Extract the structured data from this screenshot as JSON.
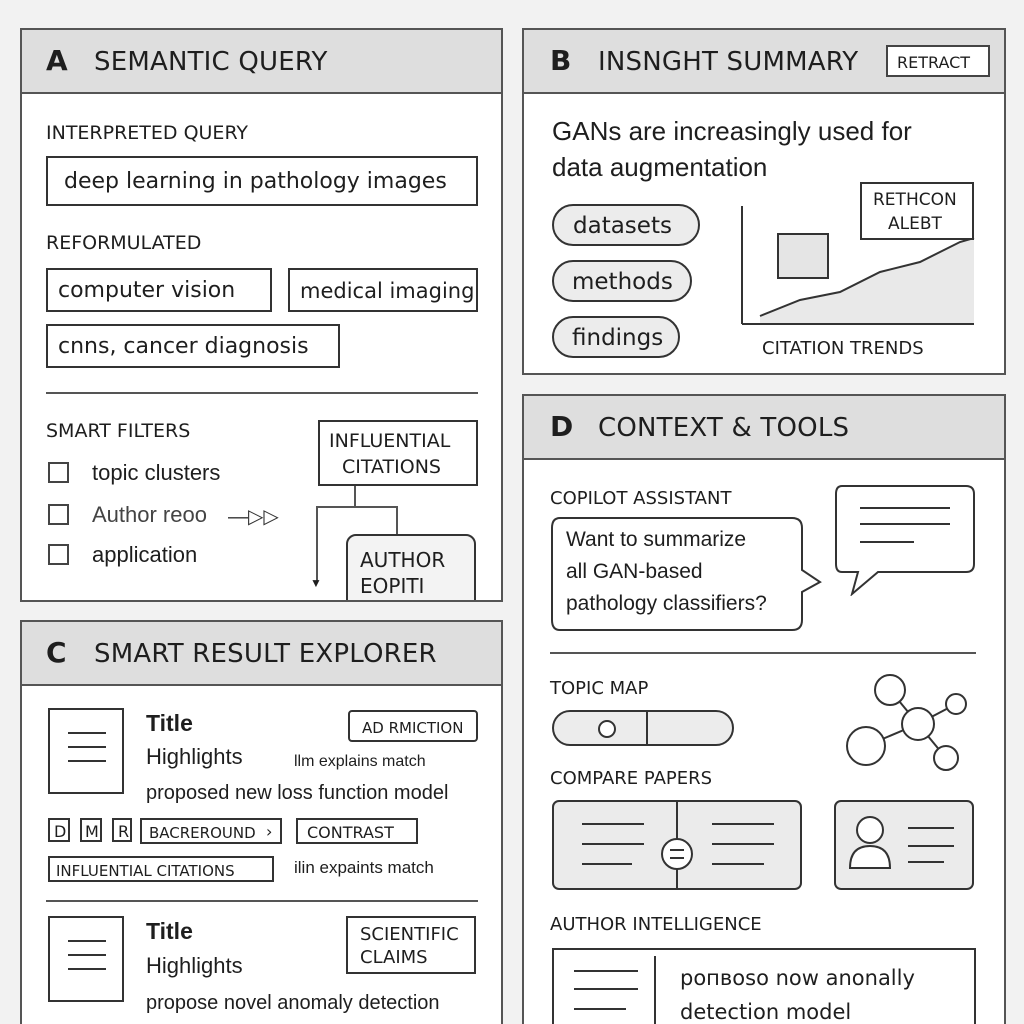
{
  "panel_a": {
    "letter": "A",
    "title": "SEMANTIC QUERY",
    "interpreted_label": "INTERPRETED QUERY",
    "interpreted_query": "deep learning in pathology images",
    "reformulated_label": "REFORMULATED",
    "reformulated_terms": [
      "computer vision",
      "medical imaging",
      "cnns, cancer diagnosis"
    ],
    "filters_label": "SMART FILTERS",
    "filters": [
      "topic clusters",
      "Author reoo",
      "application"
    ],
    "filter_arrow": "—▷▷",
    "influential_box": [
      "INFLUENTIAL",
      "CITATIONS"
    ],
    "author_box": [
      "AUTHOR",
      "EOPITI"
    ]
  },
  "panel_b": {
    "letter": "B",
    "title": "INSNGHT SUMMARY",
    "retract_button": "RETRACT",
    "summary_line1": "GANs are increasingly used for",
    "summary_line2": "data augmentation",
    "pills": [
      "datasets",
      "methods",
      "findings"
    ],
    "alert_box": [
      "RETHCON",
      "ALEBT"
    ],
    "chart_caption": "CITATION TRENDS"
  },
  "panel_c": {
    "letter": "C",
    "title": "SMART RESULT EXPLORER",
    "result1": {
      "title": "Title",
      "highlights": "Highlights",
      "tag": "AD RMICTION",
      "llm_note": "llm explains match",
      "summary": "proposed new loss function model",
      "letter_tags": [
        "D",
        "M",
        "R"
      ],
      "background_tag": "BACREROUND",
      "contrast_tag": "CONTRAST",
      "influential_tag": "INFLUENTIAL CITATIONS",
      "match_note": "ilin expaints match"
    },
    "result2": {
      "title": "Title",
      "highlights": "Highlights",
      "tag": [
        "SCIENTIFIC",
        "CLAIMS"
      ],
      "summary": "propose novel anomaly detection"
    }
  },
  "panel_d": {
    "letter": "D",
    "title": "CONTEXT & TOOLS",
    "copilot_label": "COPILOT ASSISTANT",
    "copilot_message": [
      "Want to summarize",
      "all GAN-based",
      "pathology classifiers?"
    ],
    "topic_map_label": "TOPIC MAP",
    "compare_label": "COMPARE PAPERS",
    "author_label": "AUTHOR INTELLIGENCE",
    "author_text": [
      "poпвoso now anonally",
      "detection model"
    ]
  }
}
